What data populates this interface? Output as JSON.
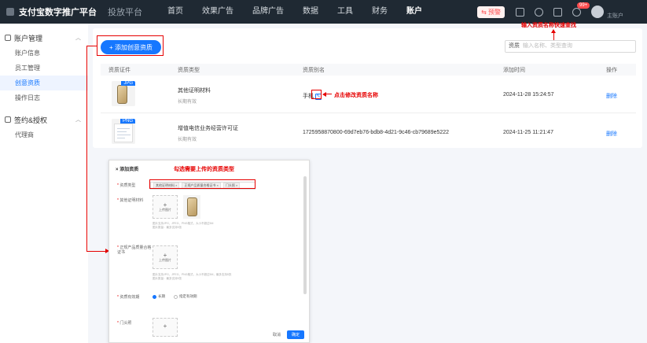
{
  "nav": {
    "brand": "支付宝数字推广平台",
    "sub_brand": "投放平台",
    "items": [
      "首页",
      "效果广告",
      "品牌广告",
      "数据",
      "工具",
      "财务",
      "账户"
    ],
    "warning": "⇆ 预警",
    "badge": "99+",
    "user": "主账户"
  },
  "sidebar": {
    "group1": "账户管理",
    "items1": [
      "账户信息",
      "员工管理",
      "创意资质",
      "操作日志"
    ],
    "group2": "签约&授权",
    "items2": [
      "代理商"
    ]
  },
  "toolbar": {
    "add_label": "+ 添加创意资质",
    "search_label": "资质",
    "search_placeholder": "输入名称、类型查询"
  },
  "table": {
    "headers": [
      "资质证件",
      "资质类型",
      "资质别名",
      "添加时间",
      "操作"
    ],
    "rows": [
      {
        "file_type": "JPG",
        "type": "其他证明材料",
        "validity": "长期有效",
        "alias": "手机",
        "time": "2024-11-28 15:24:57",
        "action": "删除"
      },
      {
        "file_type": "PNG",
        "type": "增值电信业务经营许可证",
        "validity": "长期有效",
        "alias": "1725958870800-69d7eb76-bdb8-4d21-9c46-cb79689e5222",
        "time": "2024-11-25 11:21:47",
        "action": "删除"
      }
    ]
  },
  "annotations": {
    "search_hint": "输入资质名称快速查找",
    "edit_hint": "点击修改资质名称",
    "type_hint": "勾选需要上传的资质类型"
  },
  "modal": {
    "title": "添加资质",
    "type_label": "资质类型",
    "tags": [
      "其他证明材料 ×",
      "正规产品质量合格证书 ×",
      "门头照 ×"
    ],
    "field1_label": "其他证明材料",
    "upload_label": "上传图片",
    "hint1a": "图片支持JPG、JPEG、PNG格式，大小不超过5M",
    "hint1b": "图片数量：最多支持5张",
    "field2_label": "正规产品质量合格证书",
    "hint2a": "图片支持JPG、JPEG、PNG格式，大小不超过5M，最多支持5张",
    "hint2b": "图片数量：最多支持5张",
    "validity_label": "资质有效期",
    "radio_long": "长期",
    "radio_fixed": "指定有效期",
    "field3_label": "门头照",
    "cancel": "取消",
    "ok": "确定"
  }
}
